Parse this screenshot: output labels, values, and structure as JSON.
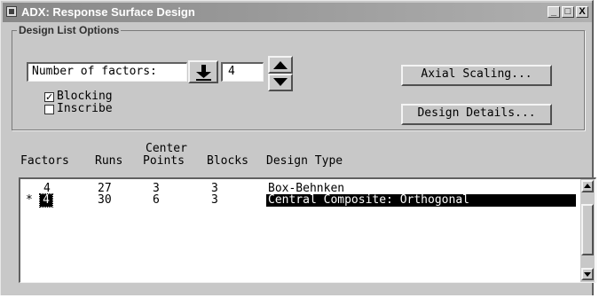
{
  "window": {
    "title": "ADX: Response Surface Design",
    "minimize": "_",
    "maximize": "□",
    "close": "X"
  },
  "group": {
    "label": "Design List Options",
    "factors_label": "Number of factors:",
    "factors_value": "4",
    "blocking_label": "Blocking",
    "blocking_checked": true,
    "inscribe_label": "Inscribe",
    "inscribe_checked": false,
    "axial_button": "Axial Scaling...",
    "details_button": "Design Details..."
  },
  "table": {
    "headers": {
      "factors": "Factors",
      "runs": "Runs",
      "center_top": "Center",
      "center_bottom": "Points",
      "blocks": "Blocks",
      "design_type": "Design Type"
    },
    "rows": [
      {
        "marker": "",
        "factors": "4",
        "runs": "27",
        "center_points": "3",
        "blocks": "3",
        "design_type": "Box-Behnken",
        "selected": false
      },
      {
        "marker": "*",
        "factors": "4",
        "runs": "30",
        "center_points": "6",
        "blocks": "3",
        "design_type": "Central Composite: Orthogonal",
        "selected": true
      }
    ]
  }
}
